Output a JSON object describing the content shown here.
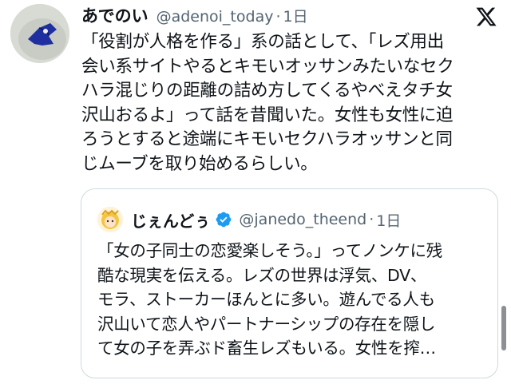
{
  "post": {
    "display_name": "あでのい",
    "handle": "@adenoi_today",
    "separator": "·",
    "time": "1日",
    "text": "「役割が人格を作る」系の話として、「レズ用出\n会い系サイトやるとキモいオッサンみたいなセク\nハラ混じりの距離の詰め方してくるやべえタチ女\n沢山おるよ」って話を昔聞いた。女性も女性に迫\nろうとすると途端にキモいセクハラオッサンと同\nじムーブを取り始めるらしい。"
  },
  "quote": {
    "display_name": "じぇんどぅ",
    "handle": "@janedo_theend",
    "separator": "·",
    "time": "1日",
    "text": "「女の子同士の恋愛楽しそう。」ってノンケに残\n酷な現実を伝える。レズの世界は浮気、DV、\nモラ、ストーカーほんとに多い。遊んでる人も\n沢山いて恋人やパートナーシップの存在を隠し\nて女の子を弄ぶド畜生レズもいる。女性を搾…"
  },
  "icons": {
    "platform": "x-logo-icon",
    "verified": "verified-badge-icon"
  },
  "colors": {
    "text": "#0f1419",
    "secondary": "#536471",
    "border": "#cfd9de",
    "verified": "#1d9bf0"
  }
}
